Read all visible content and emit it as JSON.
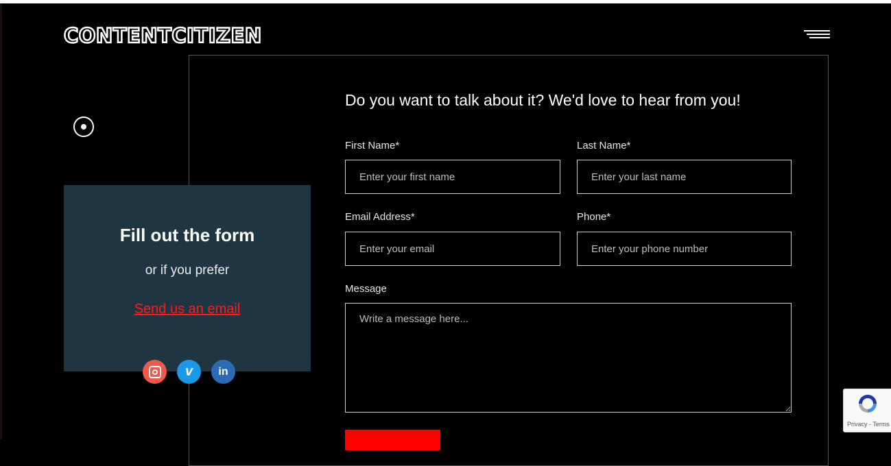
{
  "brand": {
    "logo_text": "CONTENTCITIZEN"
  },
  "sidebar_card": {
    "title": "Fill out the form",
    "subtitle": "or if you prefer",
    "email_link": "Send us an email"
  },
  "socials": [
    {
      "name": "instagram-icon",
      "color": "#f0584a"
    },
    {
      "name": "vimeo-icon",
      "glyph": "v",
      "color": "#1a9ae6"
    },
    {
      "name": "linkedin-icon",
      "glyph": "in",
      "color": "#2c6bb3"
    }
  ],
  "form": {
    "heading": "Do you want to talk about it? We'd love to hear from you!",
    "first_name": {
      "label": "First Name*",
      "placeholder": "Enter your first name"
    },
    "last_name": {
      "label": "Last Name*",
      "placeholder": "Enter your last name"
    },
    "email": {
      "label": "Email Address*",
      "placeholder": "Enter your email"
    },
    "phone": {
      "label": "Phone*",
      "placeholder": "Enter your phone number"
    },
    "message": {
      "label": "Message",
      "placeholder": "Write a message here..."
    },
    "submit_color": "#ff0000"
  },
  "recaptcha": {
    "footer": "Privacy - Terms"
  }
}
